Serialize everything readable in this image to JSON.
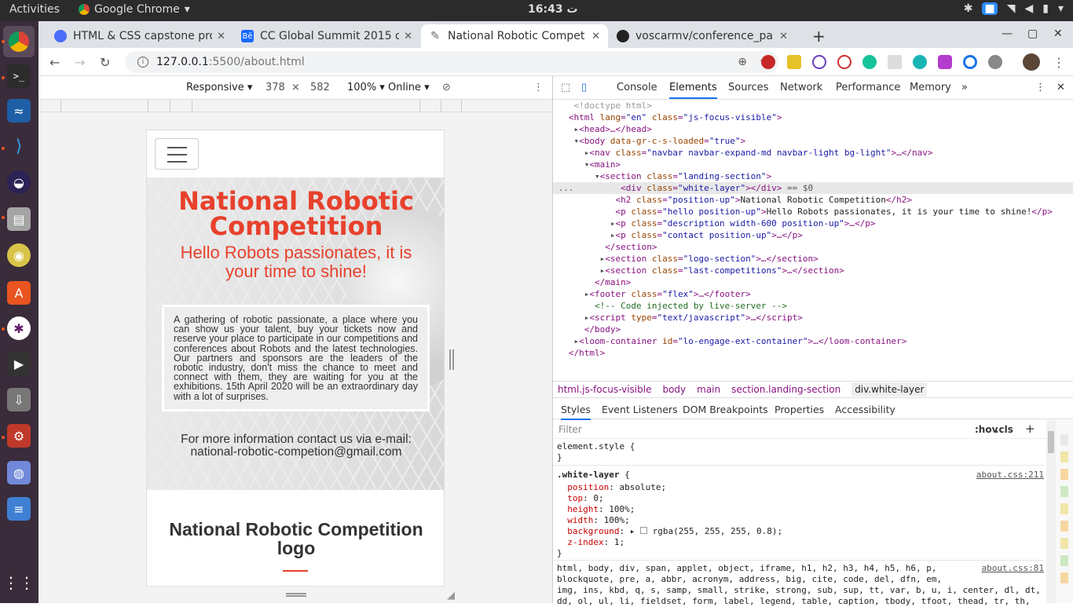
{
  "topbar": {
    "activities": "Activities",
    "app": "Google Chrome",
    "clock": "16:43",
    "clock_suffix": "ت"
  },
  "tabs": [
    {
      "title": "HTML & CSS capstone pro",
      "color": "#4a6cf7"
    },
    {
      "title": "CC Global Summit 2015 o",
      "color": "#1769ff",
      "glyph": "Bē"
    },
    {
      "title": "National Robotic Compet",
      "color": "#888"
    },
    {
      "title": "voscarmv/conference_pa",
      "color": "#222"
    }
  ],
  "new_tab": "+",
  "address": {
    "host": "127.0.0.1",
    "rest": ":5500/about.html"
  },
  "devbar": {
    "mode": "Responsive ▾",
    "width": "378",
    "x": "×",
    "height": "582",
    "zoom": "100% ▾",
    "network": "Online ▾"
  },
  "page": {
    "title": "National Robotic Competition",
    "hello": "Hello Robots passionates, it is your time to shine!",
    "description": "A gathering of robotic passionate, a place where you can show us your talent, buy your tickets now and reserve your place to participate in our competitions and conferences about Robots and the latest technologies. Our partners and sponsors are the leaders of the robotic industry, don't miss the chance to meet and connect with them, they are waiting for you at the exhibitions. 15th April 2020 will be an extraordinary day with a lot of surprises.",
    "contact_line1": "For more information contact us via e-mail:",
    "contact_line2": "national-robotic-competion@gmail.com",
    "logo_heading": "National Robotic Competition logo"
  },
  "devtools": {
    "tabs": [
      "Console",
      "Elements",
      "Sources",
      "Network",
      "Performance",
      "Memory"
    ],
    "more": "»",
    "breadcrumbs": [
      "html.js-focus-visible",
      "body",
      "main",
      "section.landing-section",
      "div.white-layer"
    ],
    "style_tabs": [
      "Styles",
      "Event Listeners",
      "DOM Breakpoints",
      "Properties",
      "Accessibility"
    ],
    "filter_placeholder": "Filter",
    "hov": ":hov",
    "cls": ".cls",
    "plus": "+",
    "rule1_src": "about.css:211",
    "rule2_src": "about.css:81",
    "html_l1": "html, body, div, span, applet, object, iframe, h1, h2, h3, h4, h5, h6, p,",
    "html_l2": "blockquote, pre, a, abbr, acronym, address, big, cite, code, del, dfn, em,",
    "html_l3": "img, ins, kbd, q, s, samp, small, strike, strong, sub, sup, tt, var, b, u, i, center, dl, dt,",
    "html_l4": "dd, ol, ul, li, fieldset, form, label, legend, table, caption, tbody, tfoot, thead, tr, th,"
  },
  "colors": {
    "accent": "#e8412c",
    "devtools_blue": "#1a73e8"
  }
}
